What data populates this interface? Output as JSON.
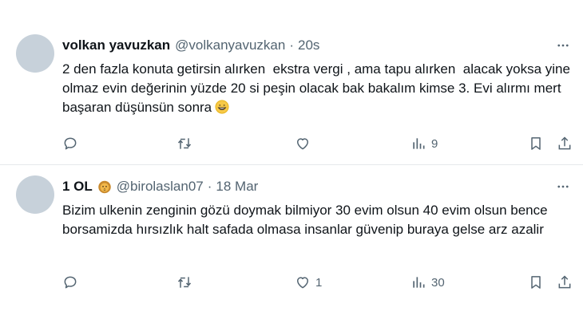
{
  "tweets": [
    {
      "name": "volkan yavuzkan",
      "handle": "@volkanyavuzkan",
      "dot": "·",
      "time": "20s",
      "text": "2 den fazla konuta getirsin alırken  ekstra vergi , ama tapu alırken  alacak yoksa yine olmaz evin değerinin yüzde 20 si peşin olacak bak bakalım kimse 3. Evi alırmı mert başaran düşünsün sonra",
      "emoji": "grinning-face-icon",
      "replies": "",
      "retweets": "",
      "likes": "",
      "views": "9"
    },
    {
      "name": "1 OL",
      "handle": "@birolaslan07",
      "dot": "·",
      "time": "18 Mar",
      "name_emoji": "lion-face-icon",
      "text": "Bizim ulkenin zenginin gözü doymak bilmiyor 30 evim olsun 40 evim olsun bence borsamizda hırsızlık halt safada olmasa insanlar güvenip buraya gelse arz azalir",
      "replies": "",
      "retweets": "",
      "likes": "1",
      "views": "30"
    }
  ],
  "colors": {
    "text": "#0f1419",
    "muted": "#536471",
    "avatar": "#c7d1da",
    "divider": "#e6e9ec"
  }
}
